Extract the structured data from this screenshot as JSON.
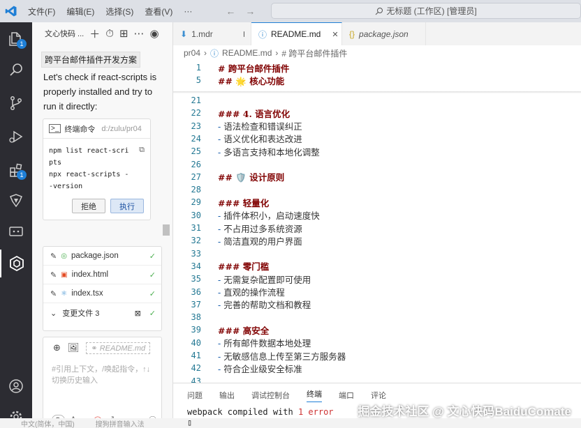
{
  "titlebar": {
    "menus": [
      "文件(F)",
      "编辑(E)",
      "选择(S)",
      "查看(V)",
      "···"
    ],
    "nav_back": "←",
    "nav_forward": "→",
    "search_text": "无标题 (工作区) [管理员]"
  },
  "activitybar": {
    "explorer_badge": "1",
    "extensions_badge": "1"
  },
  "chat": {
    "title": "文心快码 ...",
    "context_tag": "跨平台邮件插件开发方案",
    "message": "Let's check if react-scripts is properly installed and try to run it directly:",
    "terminal": {
      "label": "终端命令",
      "path": "d:/zulu/pr04",
      "code": "npm list react-scripts\nnpx react-scripts --version",
      "reject_label": "拒绝",
      "execute_label": "执行"
    },
    "files": [
      {
        "name": "package.json",
        "icon_color": "#4caf50"
      },
      {
        "name": "index.html",
        "icon_color": "#e44d26"
      },
      {
        "name": "index.tsx",
        "icon_color": "#3d8fd1"
      }
    ],
    "changed_files_label": "变更文件 3",
    "input": {
      "file_chip": "README.md",
      "placeholder": "#引用上下文，/唤起指令，↑↓切换历史输入",
      "mode": "A..."
    }
  },
  "statusbar": {
    "left": "中文(简体，中国)",
    "right": "搜狗拼音输入法"
  },
  "tabs": [
    {
      "label": "1.mdr",
      "active": false,
      "dirty": true
    },
    {
      "label": "README.md",
      "active": true,
      "dirty": false
    },
    {
      "label": "package.json",
      "active": false,
      "dirty": false
    }
  ],
  "breadcrumb": {
    "folder": "pr04",
    "file": "README.md",
    "symbol": "# 跨平台邮件插件"
  },
  "editor": {
    "lines": [
      {
        "n": "1",
        "text": "# 跨平台邮件插件",
        "kind": "heading"
      },
      {
        "n": "5",
        "text": "## 🌟 核心功能",
        "kind": "heading"
      },
      {
        "n": "21",
        "text": "",
        "kind": "text"
      },
      {
        "n": "22",
        "text": "### 4. 语言优化",
        "kind": "heading"
      },
      {
        "n": "23",
        "text": "语法检查和错误纠正",
        "kind": "bullet"
      },
      {
        "n": "24",
        "text": "语义优化和表达改进",
        "kind": "bullet"
      },
      {
        "n": "25",
        "text": "多语言支持和本地化调整",
        "kind": "bullet"
      },
      {
        "n": "26",
        "text": "",
        "kind": "text"
      },
      {
        "n": "27",
        "text": "## 🛡️ 设计原则",
        "kind": "heading"
      },
      {
        "n": "28",
        "text": "",
        "kind": "text"
      },
      {
        "n": "29",
        "text": "### 轻量化",
        "kind": "heading"
      },
      {
        "n": "30",
        "text": "插件体积小，启动速度快",
        "kind": "bullet"
      },
      {
        "n": "31",
        "text": "不占用过多系统资源",
        "kind": "bullet"
      },
      {
        "n": "32",
        "text": "简洁直观的用户界面",
        "kind": "bullet"
      },
      {
        "n": "33",
        "text": "",
        "kind": "text"
      },
      {
        "n": "34",
        "text": "### 零门槛",
        "kind": "heading"
      },
      {
        "n": "35",
        "text": "无需复杂配置即可使用",
        "kind": "bullet"
      },
      {
        "n": "36",
        "text": "直观的操作流程",
        "kind": "bullet"
      },
      {
        "n": "37",
        "text": "完善的帮助文档和教程",
        "kind": "bullet"
      },
      {
        "n": "38",
        "text": "",
        "kind": "text"
      },
      {
        "n": "39",
        "text": "### 高安全",
        "kind": "heading"
      },
      {
        "n": "40",
        "text": "所有邮件数据本地处理",
        "kind": "bullet"
      },
      {
        "n": "41",
        "text": "无敏感信息上传至第三方服务器",
        "kind": "bullet"
      },
      {
        "n": "42",
        "text": "符合企业级安全标准",
        "kind": "bullet"
      },
      {
        "n": "43",
        "text": "",
        "kind": "text"
      }
    ]
  },
  "panel": {
    "tabs": [
      "问题",
      "输出",
      "调试控制台",
      "终端",
      "端口",
      "评论"
    ],
    "active_tab": "终端",
    "output_prefix": "webpack compiled with ",
    "output_error": "1 error",
    "cursor": "▯"
  },
  "watermark": "掘金技术社区 @ 文心快码BaiduComate"
}
